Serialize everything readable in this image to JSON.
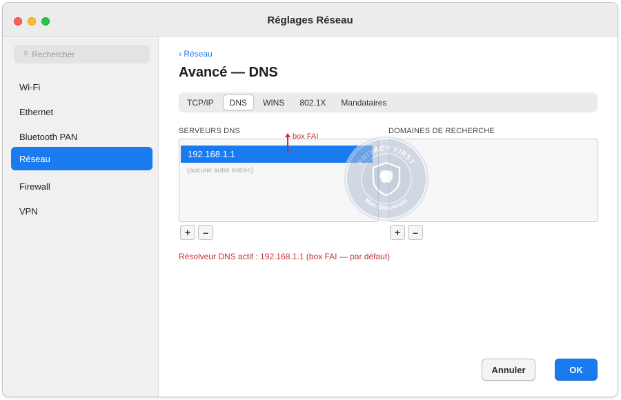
{
  "window": {
    "title": "Réglages Réseau"
  },
  "sidebar": {
    "search_placeholder": "Rechercher",
    "items": [
      {
        "label": "Wi-Fi",
        "active": false
      },
      {
        "label": "Ethernet",
        "active": false
      },
      {
        "label": "Bluetooth PAN",
        "active": false
      },
      {
        "label": "Réseau",
        "active": true
      },
      {
        "label": "Firewall",
        "active": false
      },
      {
        "label": "VPN",
        "active": false
      }
    ]
  },
  "main": {
    "back_label": "‹ Réseau",
    "heading": "Avancé — DNS",
    "tabs": [
      {
        "label": "TCP/IP",
        "selected": false
      },
      {
        "label": "DNS",
        "selected": true
      },
      {
        "label": "WINS",
        "selected": false
      },
      {
        "label": "802.1X",
        "selected": false
      },
      {
        "label": "Mandataires",
        "selected": false
      }
    ],
    "dns_servers": {
      "label": "SERVEURS DNS",
      "entries": [
        "192.168.1.1"
      ],
      "empty_note": "(aucune autre entrée)",
      "annotation": "box FAI"
    },
    "search_domains": {
      "label": "DOMAINES DE RECHERCHE",
      "entries": []
    },
    "add_label": "+",
    "remove_label": "–",
    "resolver_note": "Résolveur DNS actif : 192.168.1.1 (box FAI — par défaut)",
    "cancel_label": "Annuler",
    "ok_label": "OK"
  },
  "watermark": {
    "top_text": "PRIVACY FIRST",
    "bottom_text": "Mac Souverain"
  },
  "colors": {
    "accent": "#1a7bf0",
    "annotation": "#c2323a"
  }
}
